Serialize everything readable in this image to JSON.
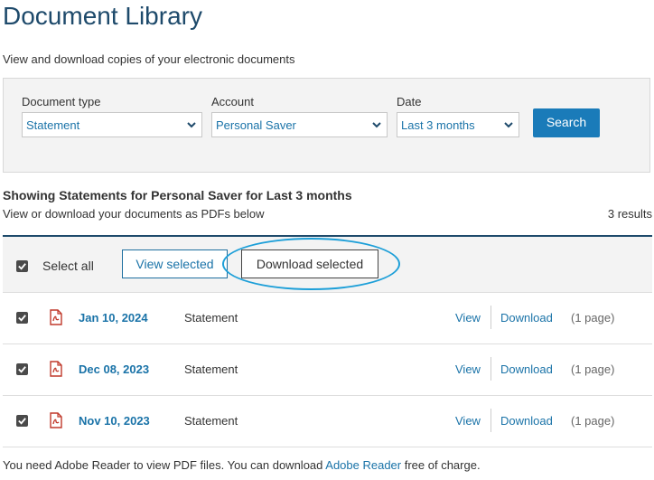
{
  "page": {
    "title": "Document Library",
    "subtitle": "View and download copies of your electronic documents"
  },
  "filters": {
    "document_type": {
      "label": "Document type",
      "value": "Statement"
    },
    "account": {
      "label": "Account",
      "value": "Personal Saver"
    },
    "date": {
      "label": "Date",
      "value": "Last 3 months"
    },
    "search_label": "Search"
  },
  "results": {
    "heading": "Showing Statements for Personal Saver for Last 3 months",
    "subheading": "View or download your documents as PDFs below",
    "count": "3 results"
  },
  "actions": {
    "select_all_label": "Select all",
    "select_all_checked": true,
    "view_selected_label": "View selected",
    "download_selected_label": "Download selected"
  },
  "documents": [
    {
      "date": "Jan 10, 2024",
      "type": "Statement",
      "view": "View",
      "download": "Download",
      "pages": "(1 page)",
      "checked": true
    },
    {
      "date": "Dec 08, 2023",
      "type": "Statement",
      "view": "View",
      "download": "Download",
      "pages": "(1 page)",
      "checked": true
    },
    {
      "date": "Nov 10, 2023",
      "type": "Statement",
      "view": "View",
      "download": "Download",
      "pages": "(1 page)",
      "checked": true
    }
  ],
  "footer": {
    "note_before": "You need Adobe Reader to view PDF files. You can download ",
    "link": "Adobe Reader",
    "note_after": " free of charge."
  },
  "colors": {
    "title": "#1e4a6b",
    "link": "#1a73a8",
    "primary_button": "#1a7bb9",
    "highlight": "#1d9fd8",
    "pdf_icon": "#c0392b"
  },
  "icons": {
    "dropdown": "chevron-down-icon",
    "checkbox": "checkbox-checked-icon",
    "document": "pdf-icon"
  }
}
